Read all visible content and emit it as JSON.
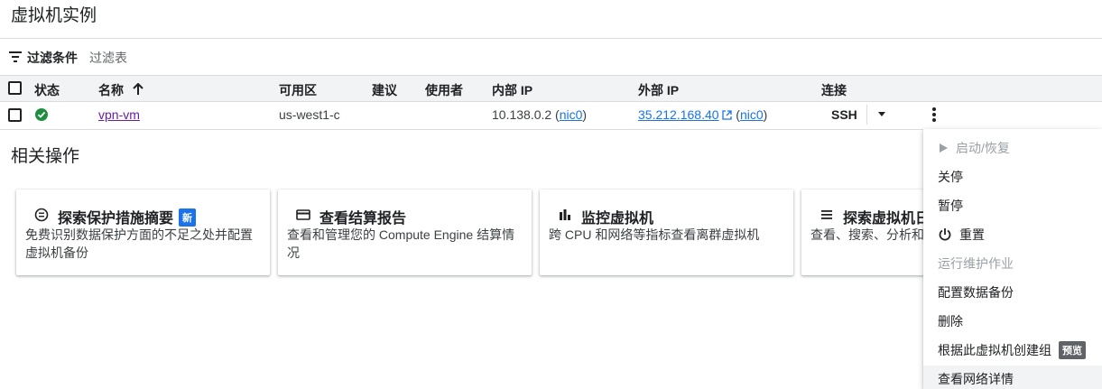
{
  "page": {
    "title": "虚拟机实例"
  },
  "filter": {
    "label": "过滤条件",
    "placeholder": "过滤表"
  },
  "table": {
    "headers": {
      "status": "状态",
      "name": "名称",
      "zone": "可用区",
      "recommendation": "建议",
      "in_use_by": "使用者",
      "internal_ip": "内部 IP",
      "external_ip": "外部 IP",
      "connect": "连接"
    },
    "rows": [
      {
        "name": "vpn-vm",
        "zone": "us-west1-c",
        "internal_ip": "10.138.0.2",
        "internal_nic": "nic0",
        "external_ip": "35.212.168.40",
        "external_nic": "nic0",
        "connect": "SSH",
        "status": "running"
      }
    ]
  },
  "related": {
    "title": "相关操作",
    "cards": [
      {
        "title": "探索保护措施摘要",
        "badge": "新",
        "desc": "免费识别数据保护方面的不足之处并配置虚拟机备份"
      },
      {
        "title": "查看结算报告",
        "desc": "查看和管理您的 Compute Engine 结算情况"
      },
      {
        "title": "监控虚拟机",
        "desc": "跨 CPU 和网络等指标查看离群虚拟机"
      },
      {
        "title": "探索虚拟机日",
        "desc": "查看、搜索、分析和下志"
      }
    ]
  },
  "menu": {
    "items": [
      {
        "label": "启动/恢复",
        "disabled": true
      },
      {
        "label": "关停"
      },
      {
        "label": "暂停"
      },
      {
        "label": "重置"
      },
      {
        "label": "运行维护作业",
        "disabled": true
      },
      {
        "label": "配置数据备份"
      },
      {
        "label": "删除"
      },
      {
        "label": "根据此虚拟机创建组",
        "badge": "预览"
      },
      {
        "label": "查看网络详情"
      }
    ]
  },
  "colors": {
    "accent": "#1a73e8",
    "visited_link": "#681da8",
    "status_ok": "#1e8e3e"
  }
}
